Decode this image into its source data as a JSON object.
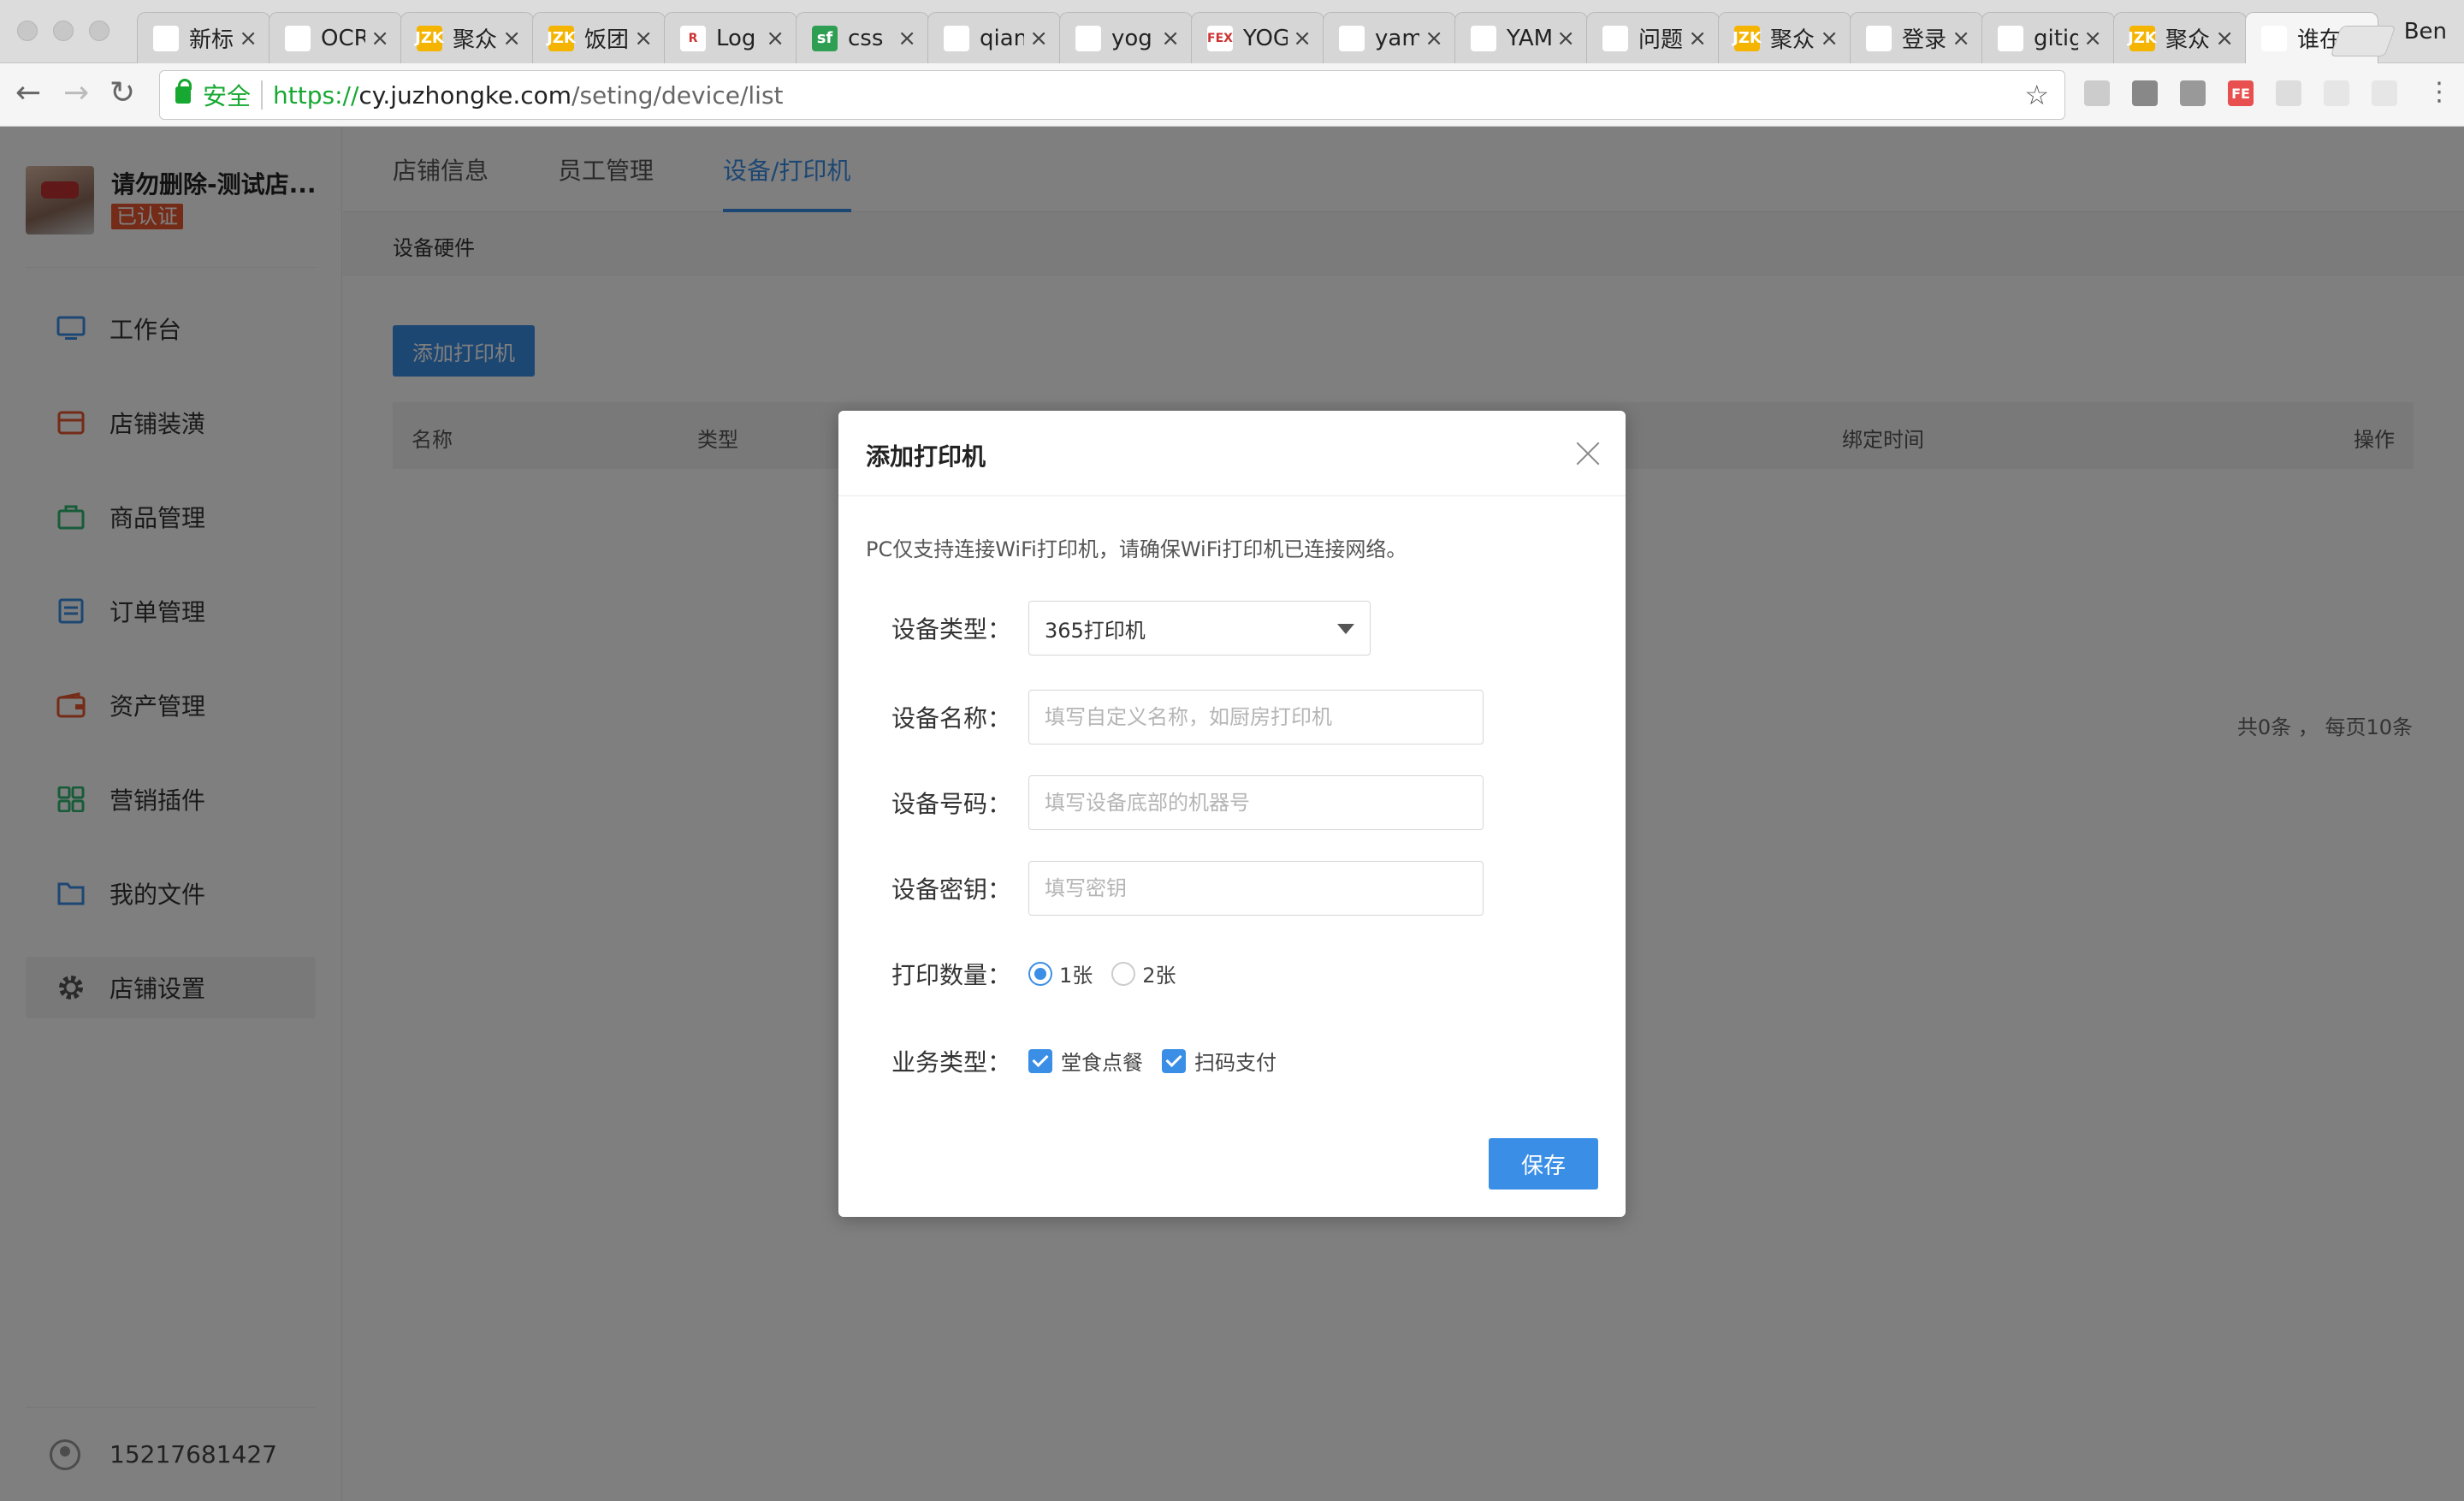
{
  "browser": {
    "tabs": [
      {
        "title": "新标签页",
        "icon_color": "#ffffff",
        "icon_text": ""
      },
      {
        "title": "OCR",
        "icon_color": "#ffffff",
        "icon_text": ""
      },
      {
        "title": "聚众",
        "icon_color": "#f5b400",
        "icon_text": "JZK"
      },
      {
        "title": "饭团",
        "icon_color": "#f5b400",
        "icon_text": "JZK"
      },
      {
        "title": "Log",
        "icon_color": "#ffffff",
        "icon_text": "R"
      },
      {
        "title": "css",
        "icon_color": "#2e9e52",
        "icon_text": "sf"
      },
      {
        "title": "qian",
        "icon_color": "#ffffff",
        "icon_text": ""
      },
      {
        "title": "yog",
        "icon_color": "#ffffff",
        "icon_text": ""
      },
      {
        "title": "YOG",
        "icon_color": "#ffffff",
        "icon_text": "FEX"
      },
      {
        "title": "yam",
        "icon_color": "#ffffff",
        "icon_text": ""
      },
      {
        "title": "YAM",
        "icon_color": "#ffffff",
        "icon_text": ""
      },
      {
        "title": "问题",
        "icon_color": "#ffffff",
        "icon_text": ""
      },
      {
        "title": "聚众",
        "icon_color": "#f5b400",
        "icon_text": "JZK"
      },
      {
        "title": "登录",
        "icon_color": "#ffffff",
        "icon_text": ""
      },
      {
        "title": "gitig",
        "icon_color": "#ffffff",
        "icon_text": ""
      },
      {
        "title": "聚众",
        "icon_color": "#f5b400",
        "icon_text": "JZK"
      },
      {
        "title": "谁在",
        "icon_color": "#ffffff",
        "icon_text": ""
      }
    ],
    "profile_name": "Ben",
    "secure_label": "安全",
    "url_scheme": "https://",
    "url_host": "cy.juzhongke.com",
    "url_path": "/seting/device/list"
  },
  "sidebar": {
    "shop_name": "请勿删除-测试店...",
    "verified_badge": "已认证",
    "items": [
      {
        "label": "工作台",
        "icon": "monitor-icon",
        "color": "#3a8ee6"
      },
      {
        "label": "店铺装潢",
        "icon": "store-icon",
        "color": "#e8562e"
      },
      {
        "label": "商品管理",
        "icon": "bag-icon",
        "color": "#2eb872"
      },
      {
        "label": "订单管理",
        "icon": "list-icon",
        "color": "#3a8ee6"
      },
      {
        "label": "资产管理",
        "icon": "wallet-icon",
        "color": "#e8562e"
      },
      {
        "label": "营销插件",
        "icon": "grid-icon",
        "color": "#2eb872"
      },
      {
        "label": "我的文件",
        "icon": "folder-icon",
        "color": "#3a8ee6"
      },
      {
        "label": "店铺设置",
        "icon": "gear-icon",
        "color": "#555555"
      }
    ],
    "phone": "15217681427"
  },
  "main": {
    "tabs": [
      "店铺信息",
      "员工管理",
      "设备/打印机"
    ],
    "subtitle": "设备硬件",
    "add_button": "添加打印机",
    "columns": [
      "名称",
      "类型",
      "绑定时间",
      "操作"
    ],
    "pager_text": "共0条 ， 每页10条"
  },
  "modal": {
    "title": "添加打印机",
    "notice": "PC仅支持连接WiFi打印机，请确保WiFi打印机已连接网络。",
    "device_type_label": "设备类型：",
    "device_type_value": "365打印机",
    "device_name_label": "设备名称：",
    "device_name_placeholder": "填写自定义名称，如厨房打印机",
    "device_number_label": "设备号码：",
    "device_number_placeholder": "填写设备底部的机器号",
    "device_key_label": "设备密钥：",
    "device_key_placeholder": "填写密钥",
    "print_count_label": "打印数量：",
    "print_options": [
      "1张",
      "2张"
    ],
    "print_selected": "1张",
    "business_label": "业务类型：",
    "business_options": [
      "堂食点餐",
      "扫码支付"
    ],
    "save_button": "保存"
  },
  "colors": {
    "accent": "#3a8ee6",
    "secure": "#17a832",
    "badge": "#e8562e"
  }
}
